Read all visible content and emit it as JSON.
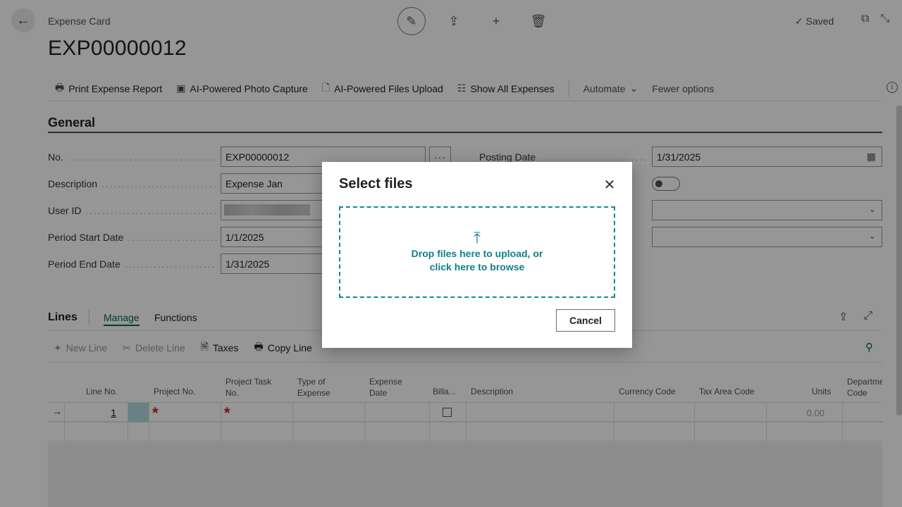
{
  "header": {
    "breadcrumb": "Expense Card",
    "title": "EXP00000012",
    "saved_label": "Saved",
    "saved_check": "✓"
  },
  "actions": [
    {
      "label": "Print Expense Report",
      "icon": "print-icon"
    },
    {
      "label": "AI-Powered Photo Capture",
      "icon": "camera-icon"
    },
    {
      "label": "AI-Powered Files Upload",
      "icon": "file-icon"
    },
    {
      "label": "Show All Expenses",
      "icon": "list-icon"
    },
    {
      "label": "Automate",
      "icon": "chevron-down-icon"
    },
    {
      "label": "Fewer options"
    }
  ],
  "general": {
    "section_title": "General",
    "no_label": "No.",
    "no_value": "EXP00000012",
    "description_label": "Description",
    "description_value": "Expense Jan",
    "userid_label": "User ID",
    "period_start_label": "Period Start Date",
    "period_start_value": "1/1/2025",
    "period_end_label": "Period End Date",
    "period_end_value": "1/31/2025",
    "posting_date_label": "Posting Date",
    "posting_date_value": "1/31/2025"
  },
  "lines": {
    "title": "Lines",
    "tabs": [
      "Manage",
      "Functions"
    ],
    "toolbar": [
      {
        "label": "New Line",
        "disabled": true
      },
      {
        "label": "Delete Line",
        "disabled": true
      },
      {
        "label": "Taxes",
        "disabled": false
      },
      {
        "label": "Copy Line",
        "disabled": false
      }
    ],
    "columns": [
      "Line No.",
      "Project No.",
      "Project Task No.",
      "Type of Expense",
      "Expense Date",
      "Billa...",
      "Description",
      "Currency Code",
      "Tax Area Code",
      "Units",
      "Departme Code"
    ],
    "rows": [
      {
        "line_no": "1",
        "units": "0.00",
        "required_mark": "*"
      }
    ]
  },
  "dialog": {
    "title": "Select files",
    "drop_text_1": "Drop files here to upload, or",
    "drop_text_2": "click here to browse",
    "cancel_label": "Cancel"
  }
}
